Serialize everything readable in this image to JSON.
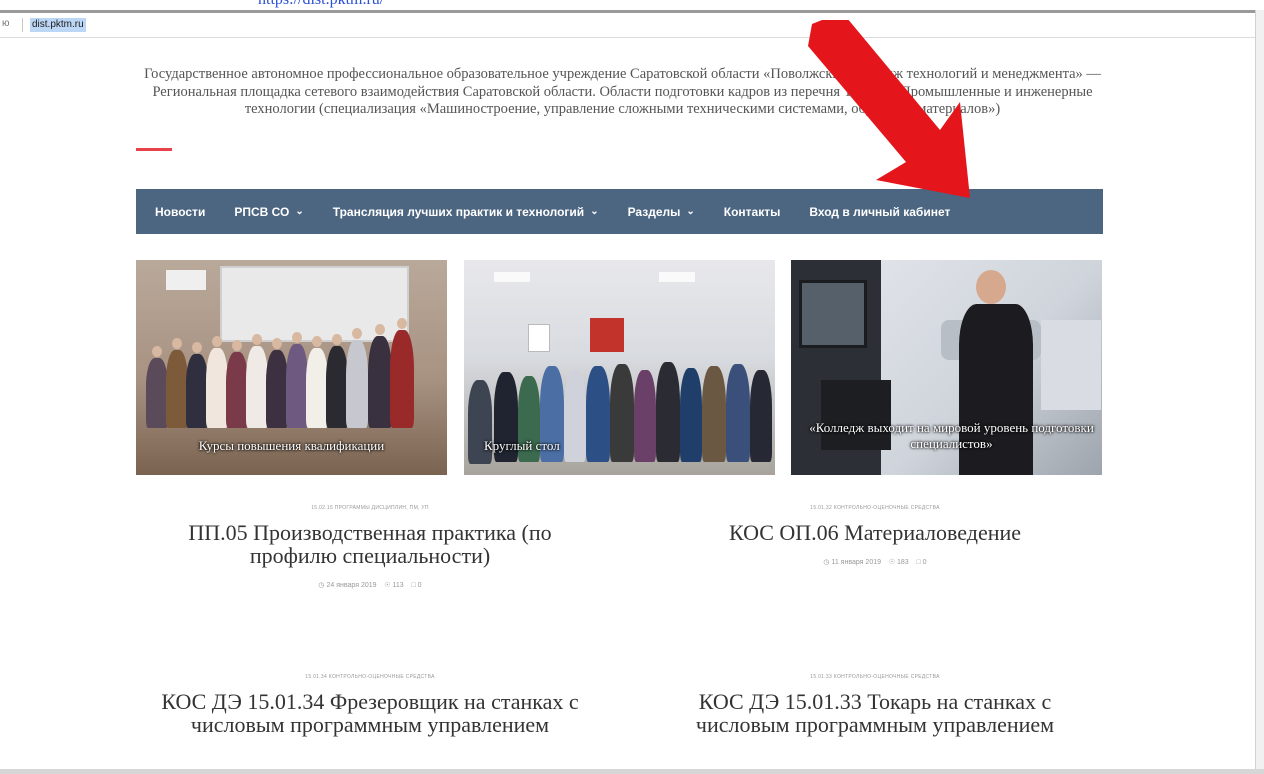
{
  "browser": {
    "top_partial_text": "https://dist.pktm.ru/",
    "tab_left": "ю",
    "url": "dist.pktm.ru"
  },
  "site": {
    "title": "Государственное автономное профессиональное образовательное учреждение Саратовской области «Поволжский колледж технологий и менеджмента» — Региональная площадка сетевого взаимодействия Саратовской области. Области подготовки кадров из перечня ТОП-50: Промышленные и инженерные технологии (специализация «Машиностроение, управление сложными техническими системами, обработка материалов»)",
    "accent_color": "#e8424a"
  },
  "nav": {
    "background": "#4c6580",
    "items": [
      {
        "label": "Новости",
        "dropdown": false
      },
      {
        "label": "РПСВ СО",
        "dropdown": true
      },
      {
        "label": "Трансляция лучших практик и технологий",
        "dropdown": true
      },
      {
        "label": "Разделы",
        "dropdown": true
      },
      {
        "label": "Контакты",
        "dropdown": false
      },
      {
        "label": "Вход в личный кабинет",
        "dropdown": false
      }
    ]
  },
  "cards": [
    {
      "caption": "Курсы повышения квалификации"
    },
    {
      "caption": "Круглый стол"
    },
    {
      "caption": "«Колледж выходит на мировой уровень подготовки специалистов»"
    }
  ],
  "articles": [
    {
      "category": "15.02.15 ПРОГРАММЫ ДИСЦИПЛИН, ПМ, УП",
      "title": "ПП.05 Производственная практика (по профилю специальности)",
      "date": "24 января 2019",
      "views": "113",
      "comments": "0"
    },
    {
      "category": "15.01.32 КОНТРОЛЬНО-ОЦЕНОЧНЫЕ СРЕДСТВА",
      "title": "КОС ОП.06 Материаловедение",
      "date": "11 января 2019",
      "views": "183",
      "comments": "0"
    },
    {
      "category": "15.01.34 КОНТРОЛЬНО-ОЦЕНОЧНЫЕ СРЕДСТВА",
      "title": "КОС ДЭ 15.01.34 Фрезеровщик на станках с числовым программным управлением"
    },
    {
      "category": "15.01.33 КОНТРОЛЬНО-ОЦЕНОЧНЫЕ СРЕДСТВА",
      "title": "КОС ДЭ 15.01.33 Токарь на станках с числовым программным управлением"
    }
  ],
  "icons": {
    "clock": "clock-icon",
    "eye": "eye-icon",
    "comment": "comment-icon",
    "chevron": "chevron-down-icon",
    "arrow": "red-arrow-annotation"
  }
}
